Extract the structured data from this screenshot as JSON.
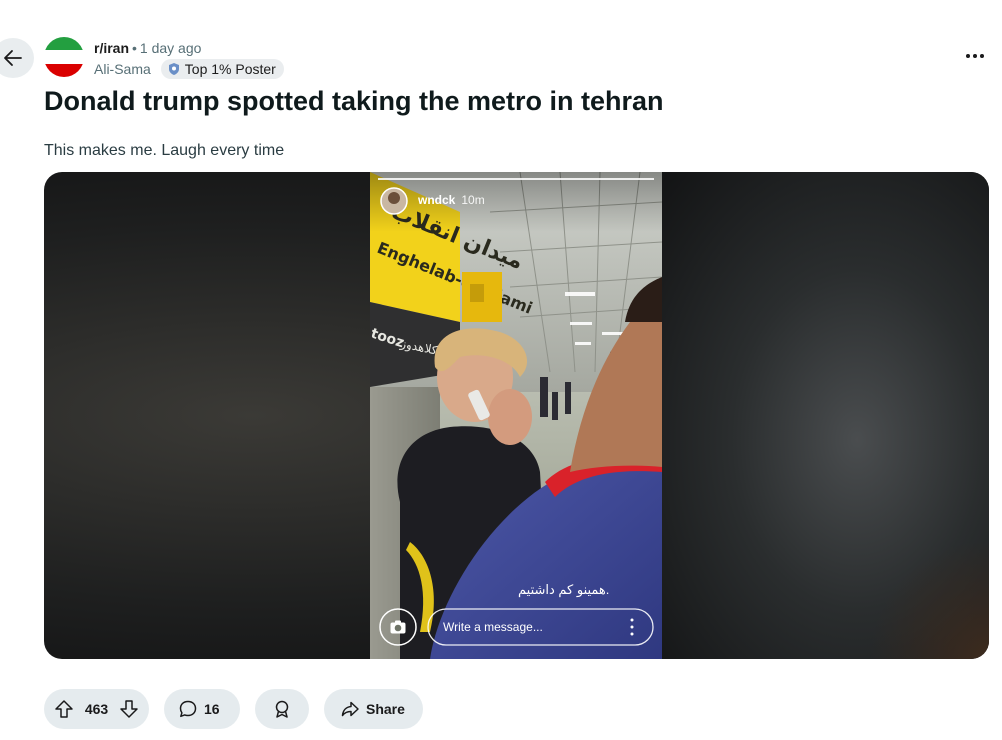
{
  "post": {
    "subreddit": "r/iran",
    "separator": "•",
    "time_ago": "1 day ago",
    "author": "Ali-Sama",
    "flair": "Top 1% Poster",
    "title": "Donald trump spotted taking the metro in tehran",
    "body": "This makes me. Laugh every time"
  },
  "media": {
    "story_user": "wndck",
    "story_time": "10m",
    "caption": "همینو کم داشتیم.",
    "sign_text": "Enghelab-e Eslami",
    "sign_fa": "میدان انقلاب",
    "sign_side": "tooz",
    "sign_fa2": "دست: شهید کلاهدوز",
    "message_placeholder": "Write a message..."
  },
  "actions": {
    "upvotes": "463",
    "comments": "16",
    "share_label": "Share"
  },
  "colors": {
    "background": "#ffffff",
    "pill_bg": "#e5ebee",
    "flag_green": "#239f40",
    "flag_red": "#da0000",
    "sign_yellow": "#f2d21b"
  },
  "icons": [
    "back-arrow-icon",
    "more-icon",
    "flair-icon",
    "upvote-icon",
    "downvote-icon",
    "comment-icon",
    "award-icon",
    "share-icon",
    "camera-icon"
  ]
}
